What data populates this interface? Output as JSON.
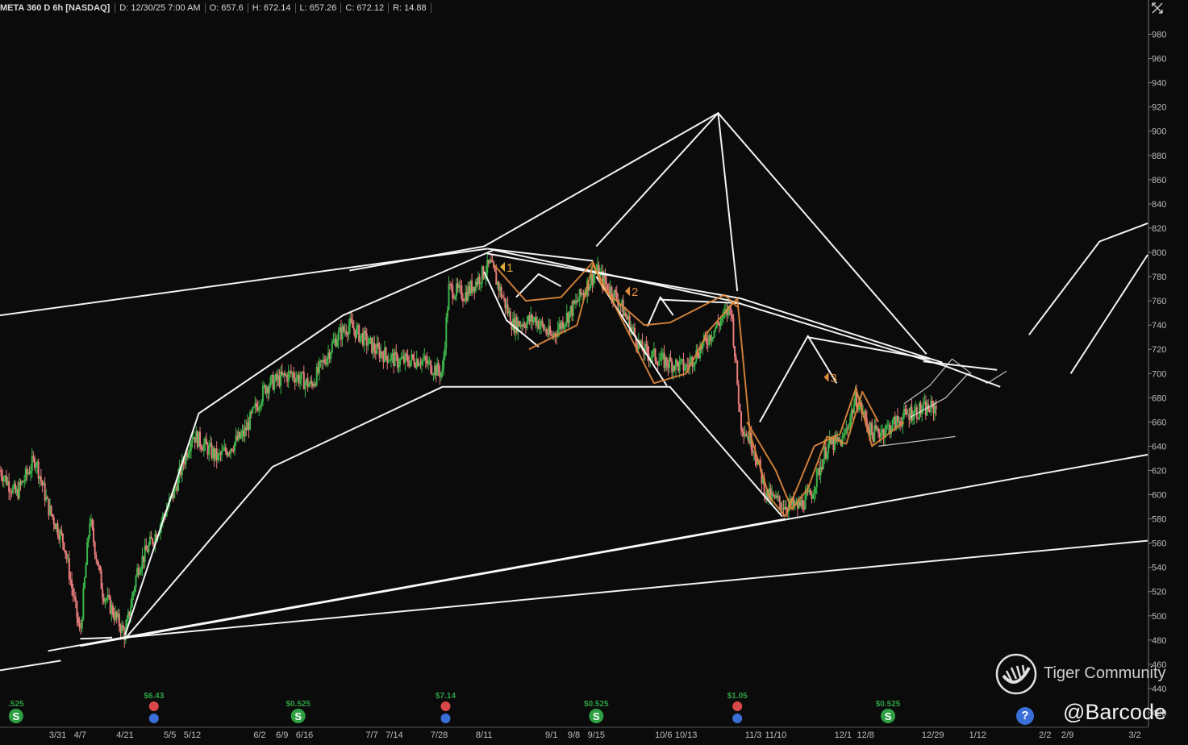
{
  "header": {
    "symbol": "META 360 D 6h [NASDAQ]",
    "date": "D: 12/30/25 7:00 AM",
    "open": "O: 657.6",
    "high": "H: 672.14",
    "low": "L: 657.26",
    "close": "C: 672.12",
    "range": "R: 14.88"
  },
  "watermark": {
    "community": "Tiger Community",
    "handle": "@Barcode"
  },
  "help_icon": "?",
  "colors": {
    "background": "#0b0b0b",
    "up": "#3bb54a",
    "down": "#e77c7c",
    "trendline": "#ffffff",
    "wave": "#e08a3c",
    "dividend": "#2ea043",
    "earnings": "#d94848",
    "earnings_info": "#3a6fd8"
  },
  "chart_data": {
    "type": "candlestick",
    "y_axis": {
      "ticks": [
        420,
        440,
        460,
        480,
        500,
        520,
        540,
        560,
        580,
        600,
        620,
        640,
        660,
        680,
        700,
        720,
        740,
        760,
        780,
        800,
        820,
        840,
        860,
        880,
        900,
        920,
        940,
        960,
        980
      ],
      "range": [
        408,
        995
      ]
    },
    "x_axis": {
      "ticks": [
        "3/31",
        "4/7",
        "4/21",
        "5/5",
        "5/12",
        "6/2",
        "6/9",
        "6/16",
        "7/7",
        "7/14",
        "7/28",
        "8/11",
        "9/1",
        "9/8",
        "9/15",
        "10/6",
        "10/13",
        "11/3",
        "11/10",
        "12/1",
        "12/8",
        "12/29",
        "1/12",
        "2/2",
        "2/9",
        "3/2"
      ],
      "range": [
        "2025-03-13",
        "2026-03-06"
      ]
    },
    "price_path": [
      [
        "2025-03-13",
        620
      ],
      [
        "2025-03-18",
        600
      ],
      [
        "2025-03-24",
        630
      ],
      [
        "2025-03-28",
        590
      ],
      [
        "2025-04-02",
        560
      ],
      [
        "2025-04-07",
        484
      ],
      [
        "2025-04-10",
        580
      ],
      [
        "2025-04-14",
        520
      ],
      [
        "2025-04-21",
        484
      ],
      [
        "2025-04-25",
        540
      ],
      [
        "2025-05-01",
        570
      ],
      [
        "2025-05-06",
        600
      ],
      [
        "2025-05-12",
        650
      ],
      [
        "2025-05-20",
        630
      ],
      [
        "2025-05-28",
        650
      ],
      [
        "2025-06-04",
        690
      ],
      [
        "2025-06-12",
        700
      ],
      [
        "2025-06-18",
        690
      ],
      [
        "2025-06-26",
        730
      ],
      [
        "2025-06-30",
        740
      ],
      [
        "2025-07-08",
        720
      ],
      [
        "2025-07-15",
        710
      ],
      [
        "2025-07-22",
        712
      ],
      [
        "2025-07-29",
        700
      ],
      [
        "2025-07-31",
        770
      ],
      [
        "2025-08-05",
        765
      ],
      [
        "2025-08-13",
        790
      ],
      [
        "2025-08-20",
        740
      ],
      [
        "2025-08-27",
        745
      ],
      [
        "2025-09-01",
        730
      ],
      [
        "2025-09-08",
        755
      ],
      [
        "2025-09-15",
        785
      ],
      [
        "2025-09-22",
        760
      ],
      [
        "2025-09-29",
        720
      ],
      [
        "2025-10-06",
        710
      ],
      [
        "2025-10-13",
        705
      ],
      [
        "2025-10-20",
        730
      ],
      [
        "2025-10-27",
        755
      ],
      [
        "2025-10-30",
        660
      ],
      [
        "2025-11-03",
        640
      ],
      [
        "2025-11-07",
        600
      ],
      [
        "2025-11-12",
        592
      ],
      [
        "2025-11-17",
        590
      ],
      [
        "2025-11-21",
        600
      ],
      [
        "2025-11-26",
        640
      ],
      [
        "2025-12-01",
        645
      ],
      [
        "2025-12-05",
        680
      ],
      [
        "2025-12-10",
        650
      ],
      [
        "2025-12-15",
        655
      ],
      [
        "2025-12-22",
        668
      ],
      [
        "2025-12-30",
        672
      ]
    ],
    "wave_labels": [
      {
        "text": "1",
        "date": "2025-08-18",
        "price": 788
      },
      {
        "text": "2",
        "date": "2025-09-26",
        "price": 768
      },
      {
        "text": "3",
        "date": "2025-11-27",
        "price": 697
      }
    ],
    "events": [
      {
        "date": "2025-03-18",
        "kind": "dividend",
        "label": ".525"
      },
      {
        "date": "2025-04-30",
        "kind": "earnings",
        "label": "$6.43"
      },
      {
        "date": "2025-06-14",
        "kind": "dividend",
        "label": "$0.525"
      },
      {
        "date": "2025-07-30",
        "kind": "earnings",
        "label": "$7.14"
      },
      {
        "date": "2025-09-15",
        "kind": "dividend",
        "label": "$0.525"
      },
      {
        "date": "2025-10-29",
        "kind": "earnings",
        "label": "$1.05"
      },
      {
        "date": "2025-12-15",
        "kind": "dividend",
        "label": "$0.525"
      }
    ],
    "trendlines": [
      [
        [
          "2025-03-13",
          748
        ],
        [
          "2025-08-12",
          803
        ]
      ],
      [
        [
          "2025-03-13",
          455
        ],
        [
          "2025-04-01",
          463
        ]
      ],
      [
        [
          "2025-03-28",
          471
        ],
        [
          "2025-11-13",
          580
        ]
      ],
      [
        [
          "2025-04-07",
          475
        ],
        [
          "2026-03-06",
          633
        ]
      ],
      [
        [
          "2025-04-21",
          482
        ],
        [
          "2026-03-06",
          562
        ]
      ],
      [
        [
          "2025-04-07",
          481
        ],
        [
          "2025-04-17",
          482
        ]
      ],
      [
        [
          "2025-04-21",
          484
        ],
        [
          "2025-05-14",
          667
        ],
        [
          "2025-06-28",
          748
        ],
        [
          "2025-08-14",
          802
        ],
        [
          "2025-10-27",
          760
        ],
        [
          "2026-01-02",
          706
        ],
        [
          "2026-01-19",
          689
        ]
      ],
      [
        [
          "2025-04-21",
          481
        ],
        [
          "2025-06-06",
          623
        ],
        [
          "2025-07-29",
          689
        ],
        [
          "2025-10-08",
          689
        ],
        [
          "2025-11-12",
          582
        ]
      ],
      [
        [
          "2025-08-12",
          803
        ],
        [
          "2025-09-14",
          793
        ]
      ],
      [
        [
          "2025-08-12",
          799
        ],
        [
          "2025-10-30",
          762
        ],
        [
          "2026-01-01",
          709
        ]
      ],
      [
        [
          "2025-08-11",
          784
        ],
        [
          "2025-08-18",
          744
        ],
        [
          "2025-08-28",
          722
        ]
      ],
      [
        [
          "2025-08-21",
          763
        ],
        [
          "2025-08-28",
          782
        ],
        [
          "2025-09-04",
          772
        ]
      ],
      [
        [
          "2025-09-15",
          780
        ],
        [
          "2025-10-07",
          690
        ]
      ],
      [
        [
          "2025-10-01",
          739
        ],
        [
          "2025-10-05",
          763
        ],
        [
          "2025-10-09",
          748
        ]
      ],
      [
        [
          "2025-10-05",
          761
        ],
        [
          "2025-10-30",
          758
        ]
      ],
      [
        [
          "2025-11-05",
          660
        ],
        [
          "2025-11-20",
          731
        ],
        [
          "2025-11-29",
          692
        ]
      ],
      [
        [
          "2025-11-20",
          730
        ],
        [
          "2025-12-28",
          712
        ]
      ],
      [
        [
          "2025-06-30",
          785
        ],
        [
          "2025-08-11",
          805
        ],
        [
          "2025-10-23",
          915
        ],
        [
          "2025-10-29",
          768
        ]
      ],
      [
        [
          "2025-09-15",
          805
        ],
        [
          "2025-10-23",
          915
        ],
        [
          "2025-12-27",
          716
        ]
      ],
      [
        [
          "2025-12-26",
          710
        ],
        [
          "2026-01-18",
          703
        ]
      ],
      [
        [
          "2026-01-28",
          732
        ],
        [
          "2026-02-19",
          809
        ],
        [
          "2026-03-06",
          824
        ]
      ],
      [
        [
          "2026-02-10",
          700
        ],
        [
          "2026-03-06",
          798
        ]
      ]
    ],
    "wave_paths": [
      [
        [
          "2025-08-14",
          790
        ],
        [
          "2025-08-24",
          760
        ],
        [
          "2025-09-04",
          763
        ],
        [
          "2025-09-14",
          792
        ],
        [
          "2025-09-17",
          770
        ],
        [
          "2025-09-30",
          740
        ],
        [
          "2025-10-08",
          742
        ],
        [
          "2025-10-25",
          765
        ],
        [
          "2025-10-29",
          755
        ]
      ],
      [
        [
          "2025-08-25",
          720
        ],
        [
          "2025-09-09",
          740
        ],
        [
          "2025-09-14",
          790
        ],
        [
          "2025-09-20",
          760
        ],
        [
          "2025-10-03",
          692
        ],
        [
          "2025-10-13",
          700
        ],
        [
          "2025-10-20",
          735
        ],
        [
          "2025-10-29",
          762
        ],
        [
          "2025-11-02",
          650
        ],
        [
          "2025-11-08",
          598
        ],
        [
          "2025-11-13",
          582
        ],
        [
          "2025-11-22",
          640
        ],
        [
          "2025-11-30",
          650
        ],
        [
          "2025-12-05",
          688
        ],
        [
          "2025-12-10",
          640
        ],
        [
          "2025-12-20",
          660
        ]
      ],
      [
        [
          "2025-11-01",
          660
        ],
        [
          "2025-11-10",
          620
        ],
        [
          "2025-11-15",
          588
        ],
        [
          "2025-11-20",
          605
        ],
        [
          "2025-11-26",
          648
        ],
        [
          "2025-12-02",
          642
        ],
        [
          "2025-12-07",
          685
        ],
        [
          "2025-12-12",
          660
        ]
      ]
    ],
    "projection_paths": [
      [
        [
          "2025-12-20",
          675
        ],
        [
          "2025-12-28",
          690
        ],
        [
          "2026-01-04",
          712
        ],
        [
          "2026-01-10",
          700
        ]
      ],
      [
        [
          "2025-12-22",
          664
        ],
        [
          "2026-01-02",
          680
        ],
        [
          "2026-01-09",
          700
        ],
        [
          "2026-01-15",
          692
        ],
        [
          "2026-01-21",
          702
        ]
      ],
      [
        [
          "2025-12-12",
          640
        ],
        [
          "2026-01-05",
          648
        ]
      ]
    ]
  }
}
